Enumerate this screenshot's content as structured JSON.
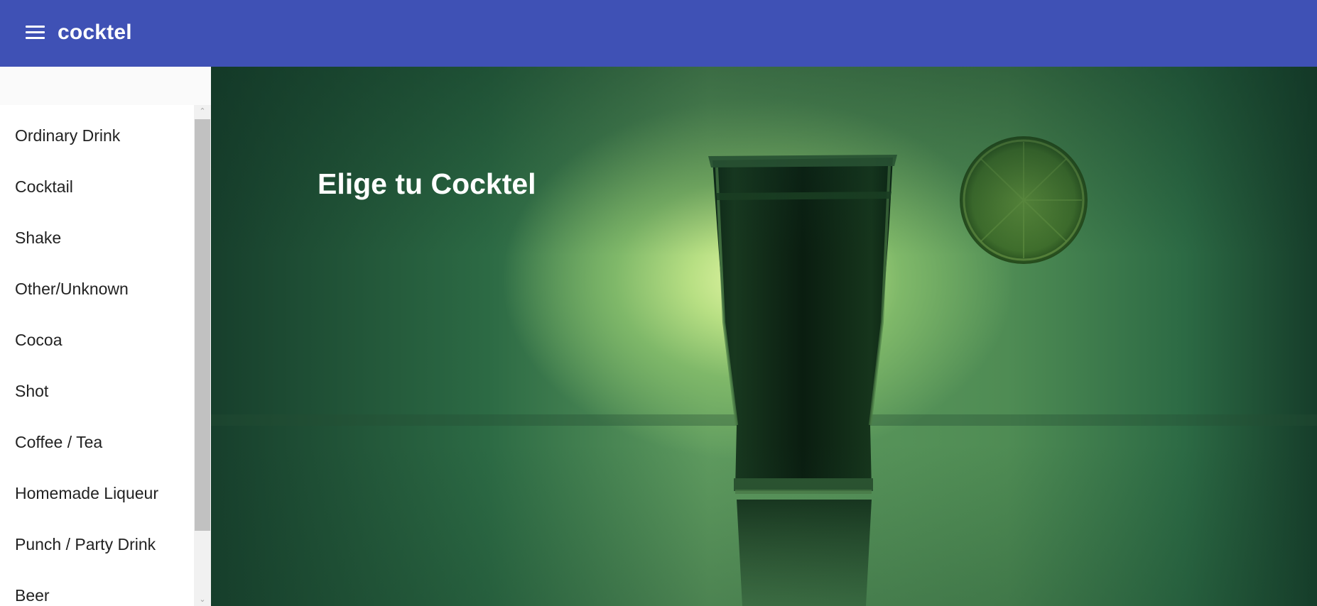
{
  "app": {
    "title": "cocktel"
  },
  "hero": {
    "heading": "Elige tu Cocktel"
  },
  "sidebar": {
    "items": [
      {
        "label": "Ordinary Drink"
      },
      {
        "label": "Cocktail"
      },
      {
        "label": "Shake"
      },
      {
        "label": "Other/Unknown"
      },
      {
        "label": "Cocoa"
      },
      {
        "label": "Shot"
      },
      {
        "label": "Coffee / Tea"
      },
      {
        "label": "Homemade Liqueur"
      },
      {
        "label": "Punch / Party Drink"
      },
      {
        "label": "Beer"
      }
    ]
  },
  "scrollbar": {
    "up_arrow": "⌃",
    "down_arrow": "⌄"
  },
  "icons": {
    "menu": "menu-icon"
  },
  "colors": {
    "toolbar": "#3f51b5",
    "sidebar_text": "#222222",
    "hero_text": "#ffffff"
  }
}
